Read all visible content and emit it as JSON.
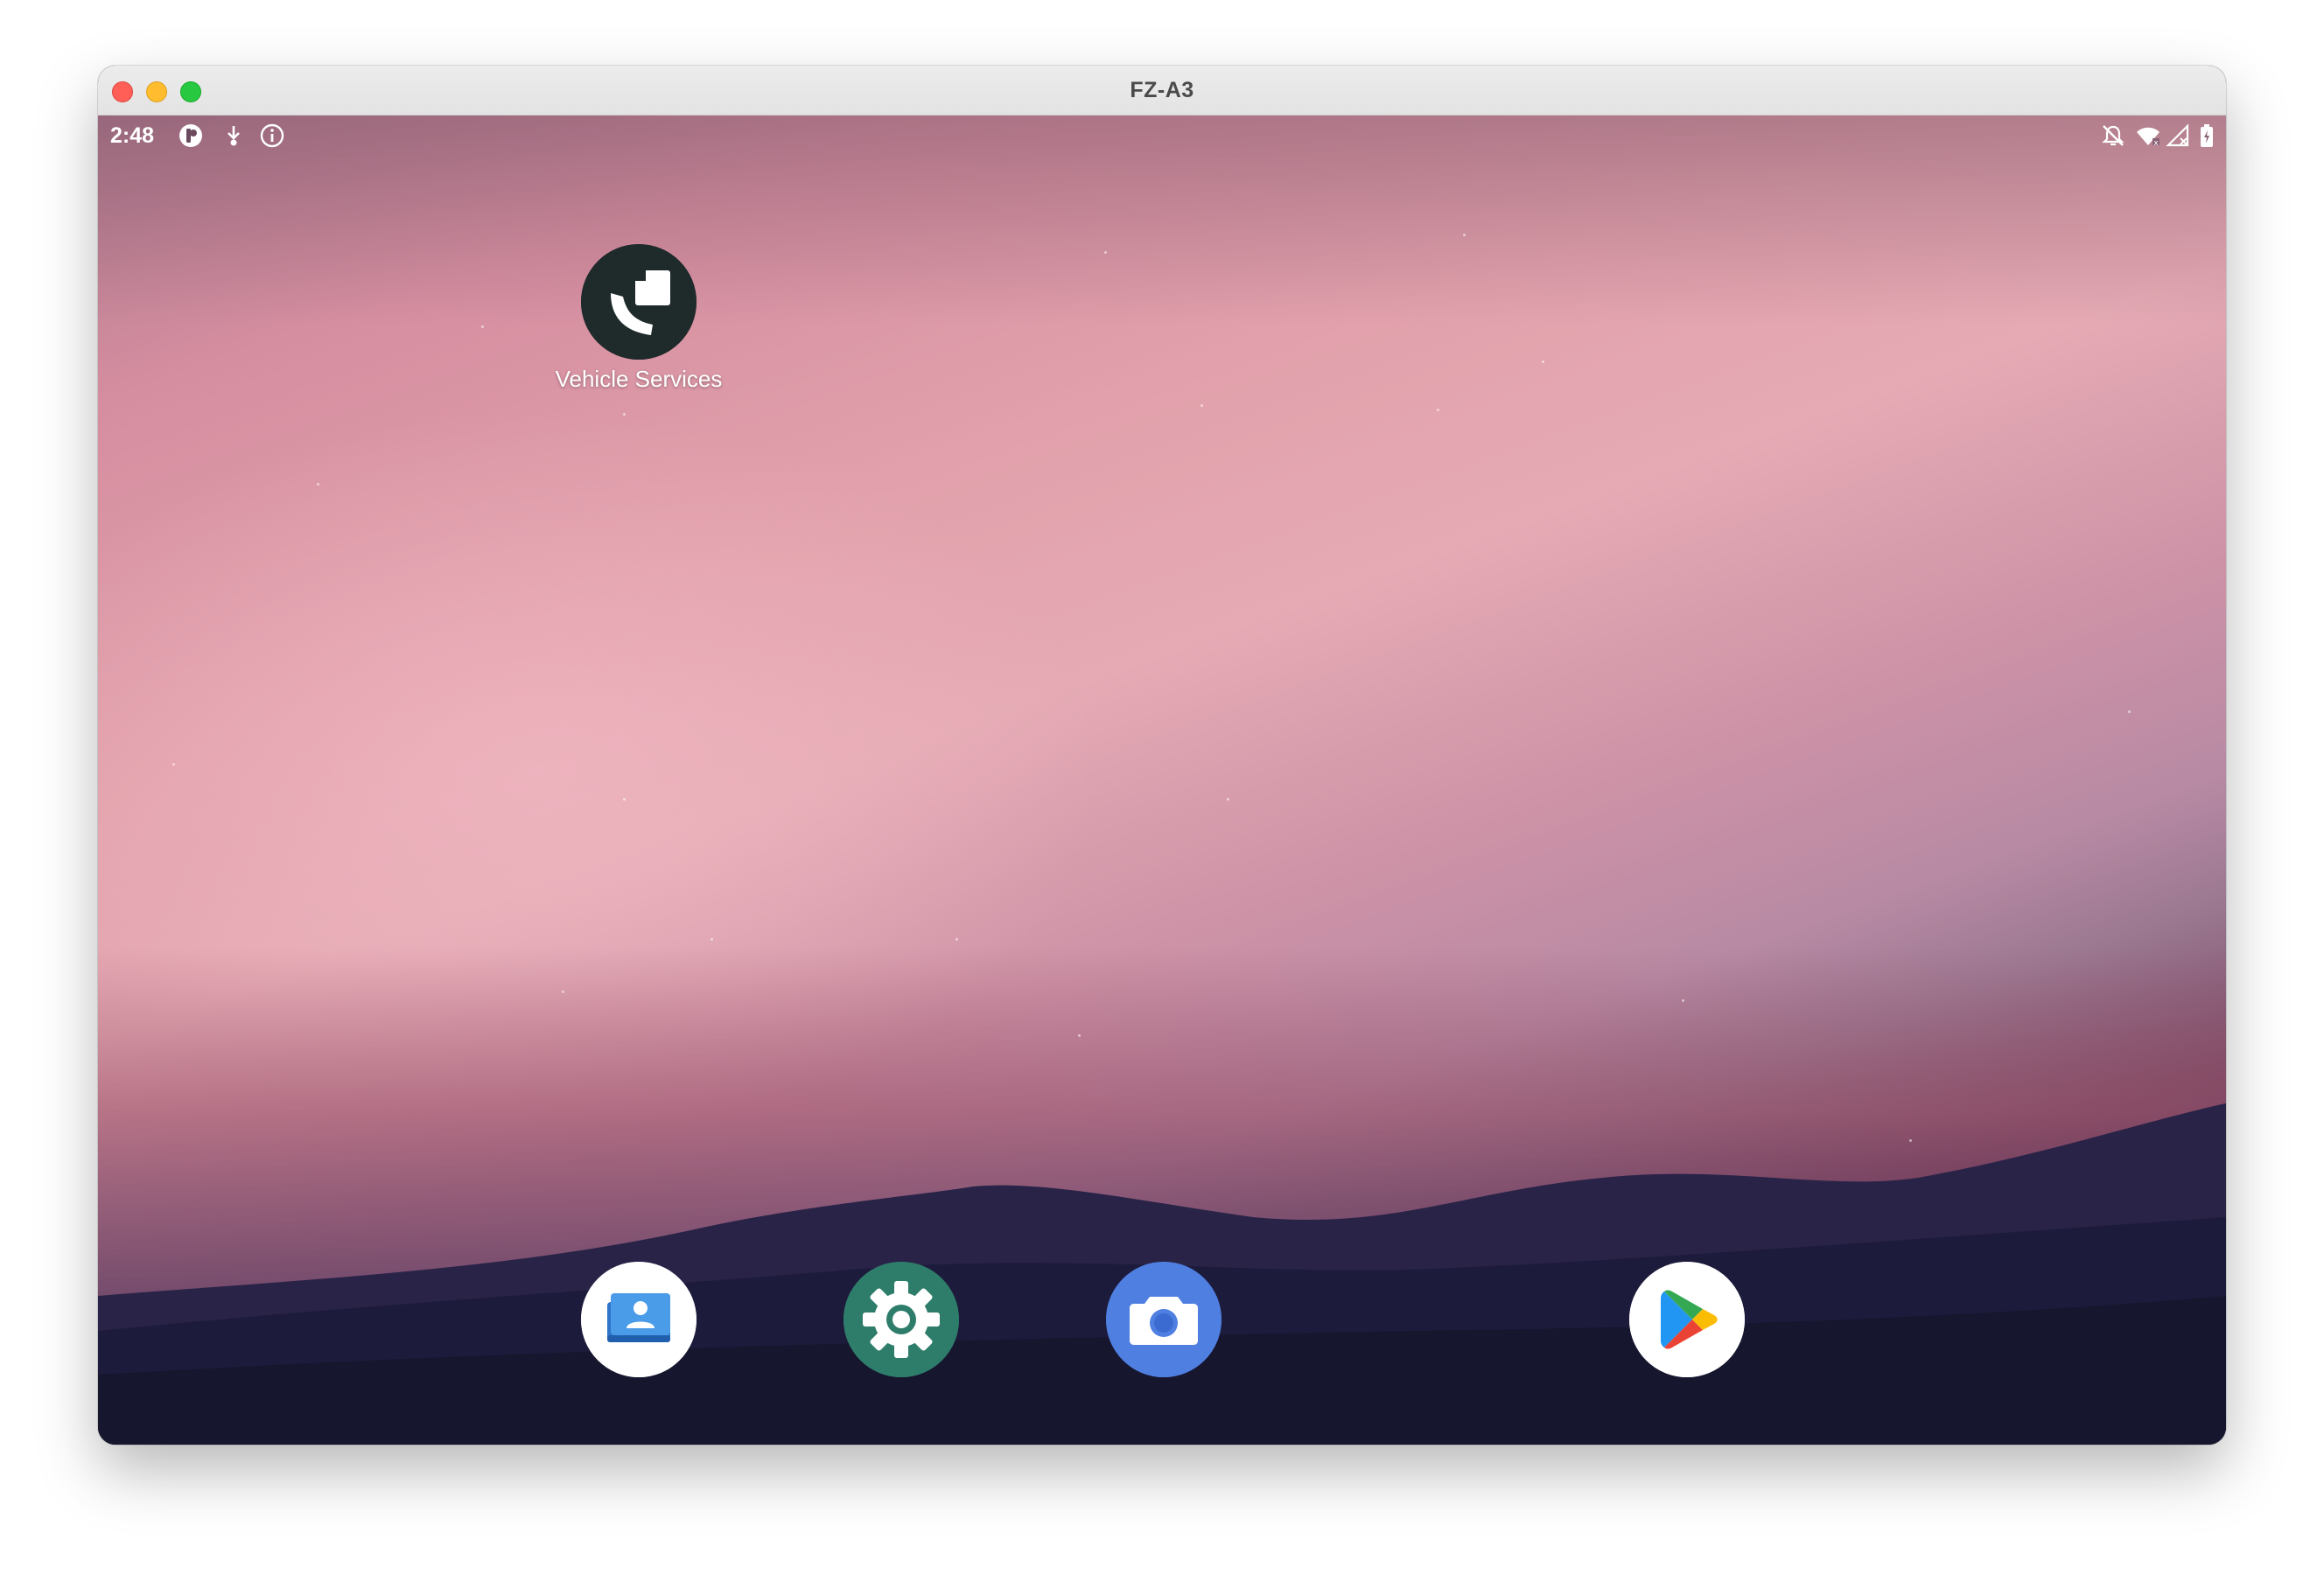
{
  "window": {
    "title": "FZ-A3"
  },
  "status_bar": {
    "time": "2:48",
    "left_icons": [
      "profile-badge-icon",
      "download-icon",
      "info-icon"
    ],
    "right_icons": [
      "notifications-off-icon",
      "wifi-icon",
      "signal-icon",
      "battery-icon"
    ]
  },
  "home_screen": {
    "apps": [
      {
        "label": "Vehicle Services",
        "icon": "vehicle-services-icon"
      }
    ]
  },
  "dock": {
    "apps": [
      {
        "icon": "contacts-icon"
      },
      {
        "icon": "settings-icon"
      },
      {
        "icon": "camera-icon"
      },
      {
        "icon": "play-store-icon"
      }
    ]
  },
  "colors": {
    "close": "#ff5f57",
    "minimize": "#febc2e",
    "maximize": "#28c840",
    "settings_bg": "#2e7d6b",
    "camera_bg": "#4f7fe0",
    "vehicle_services_bg": "#1f2a2b"
  }
}
